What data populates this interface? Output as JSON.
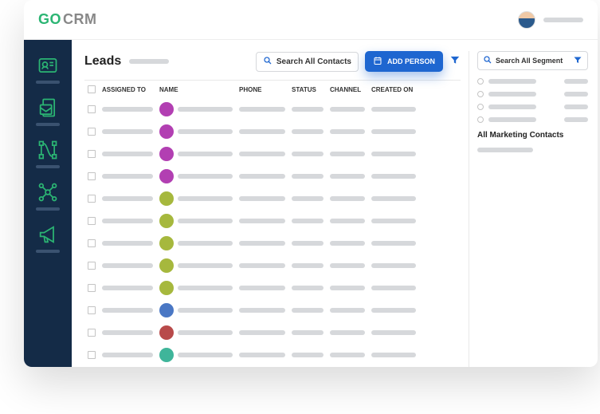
{
  "brand": {
    "left": "GO",
    "right": "CRM"
  },
  "page": {
    "title": "Leads"
  },
  "actions": {
    "search_contacts": "Search All Contacts",
    "add_person": "ADD PERSON",
    "search_segment": "Search All Segment"
  },
  "table": {
    "columns": {
      "assigned": "ASSIGNED TO",
      "name": "NAME",
      "phone": "PHONE",
      "status": "STATUS",
      "channel": "CHANNEL",
      "created": "CREATED ON"
    },
    "rows": [
      {
        "color": "#b23fb2"
      },
      {
        "color": "#b23fb2"
      },
      {
        "color": "#b23fb2"
      },
      {
        "color": "#b23fb2"
      },
      {
        "color": "#a6b83d"
      },
      {
        "color": "#a6b83d"
      },
      {
        "color": "#a6b83d"
      },
      {
        "color": "#a6b83d"
      },
      {
        "color": "#a6b83d"
      },
      {
        "color": "#4a77c4"
      },
      {
        "color": "#b84a4a"
      },
      {
        "color": "#3fb59a"
      },
      {
        "color": "#4a77c4"
      }
    ]
  },
  "segments": {
    "title": "All Marketing Contacts",
    "items": [
      {},
      {},
      {},
      {}
    ]
  },
  "icons": {
    "contacts": "contacts-icon",
    "inbox": "inbox-icon",
    "design": "design-icon",
    "network": "network-icon",
    "campaign": "campaign-icon",
    "search": "search-icon",
    "calendar": "calendar-icon",
    "filter": "filter-icon"
  }
}
